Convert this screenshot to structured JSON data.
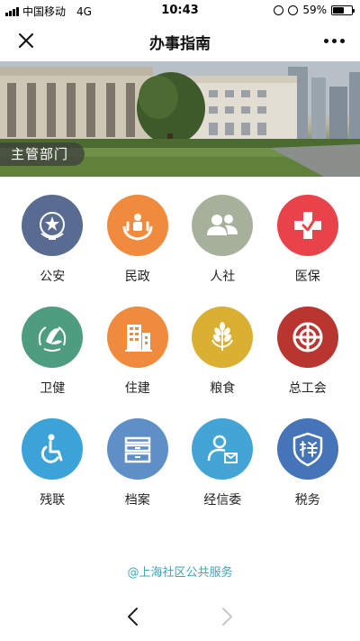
{
  "status_bar": {
    "carrier": "中国移动",
    "network": "4G",
    "time": "10:43",
    "battery_percent": "59%",
    "battery_level": 0.59
  },
  "nav": {
    "title": "办事指南",
    "close_icon": "close-icon",
    "more_icon": "more-icon"
  },
  "banner": {
    "tag": "主管部门"
  },
  "departments": [
    {
      "label": "公安",
      "icon": "police-emblem-icon",
      "color": "#5a6b92"
    },
    {
      "label": "民政",
      "icon": "civil-affairs-icon",
      "color": "#f08a3c"
    },
    {
      "label": "人社",
      "icon": "people-icon",
      "color": "#a7b09b"
    },
    {
      "label": "医保",
      "icon": "medical-cross-icon",
      "color": "#e8434a"
    },
    {
      "label": "卫健",
      "icon": "health-icon",
      "color": "#4f9d80"
    },
    {
      "label": "住建",
      "icon": "building-icon",
      "color": "#f08a3c"
    },
    {
      "label": "粮食",
      "icon": "grain-icon",
      "color": "#d9b032"
    },
    {
      "label": "总工会",
      "icon": "trade-union-icon",
      "color": "#b8362f"
    },
    {
      "label": "残联",
      "icon": "wheelchair-icon",
      "color": "#3ca3d8"
    },
    {
      "label": "档案",
      "icon": "archive-box-icon",
      "color": "#5f8fc7"
    },
    {
      "label": "经信委",
      "icon": "user-mail-icon",
      "color": "#42a5d6"
    },
    {
      "label": "税务",
      "icon": "tax-shield-icon",
      "color": "#4574b8"
    }
  ],
  "footer": {
    "link": "@上海社区公共服务"
  }
}
